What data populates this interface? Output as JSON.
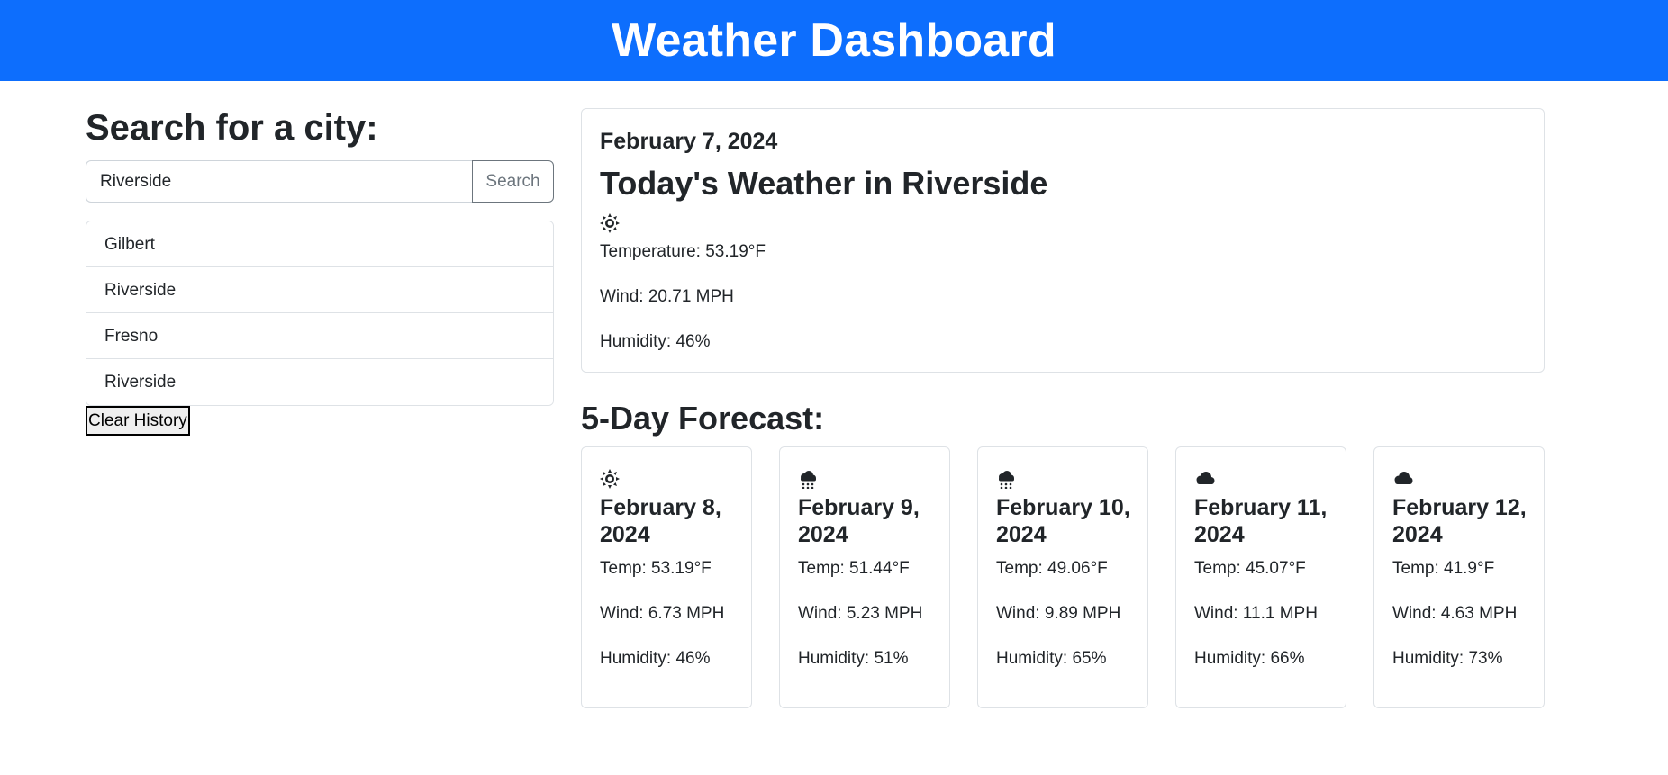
{
  "header": {
    "title": "Weather Dashboard",
    "accent_color": "#0d6efd"
  },
  "search": {
    "heading": "Search for a city:",
    "input_value": "Riverside",
    "button_label": "Search"
  },
  "history": {
    "items": [
      {
        "label": "Gilbert"
      },
      {
        "label": "Riverside"
      },
      {
        "label": "Fresno"
      },
      {
        "label": "Riverside"
      }
    ],
    "clear_label": "Clear History"
  },
  "today": {
    "date": "February 7, 2024",
    "title": "Today's Weather in Riverside",
    "icon": "sun-icon",
    "temperature": "Temperature: 53.19°F",
    "wind": "Wind: 20.71 MPH",
    "humidity": "Humidity: 46%"
  },
  "forecast": {
    "heading": "5-Day Forecast:",
    "days": [
      {
        "icon": "sun-icon",
        "date": "February 8, 2024",
        "temp": "Temp: 53.19°F",
        "wind": "Wind: 6.73 MPH",
        "humidity": "Humidity: 46%"
      },
      {
        "icon": "rain-cloud-icon",
        "date": "February 9, 2024",
        "temp": "Temp: 51.44°F",
        "wind": "Wind: 5.23 MPH",
        "humidity": "Humidity: 51%"
      },
      {
        "icon": "rain-cloud-icon",
        "date": "February 10, 2024",
        "temp": "Temp: 49.06°F",
        "wind": "Wind: 9.89 MPH",
        "humidity": "Humidity: 65%"
      },
      {
        "icon": "cloud-icon",
        "date": "February 11, 2024",
        "temp": "Temp: 45.07°F",
        "wind": "Wind: 11.1 MPH",
        "humidity": "Humidity: 66%"
      },
      {
        "icon": "cloud-icon",
        "date": "February 12, 2024",
        "temp": "Temp: 41.9°F",
        "wind": "Wind: 4.63 MPH",
        "humidity": "Humidity: 73%"
      }
    ]
  }
}
